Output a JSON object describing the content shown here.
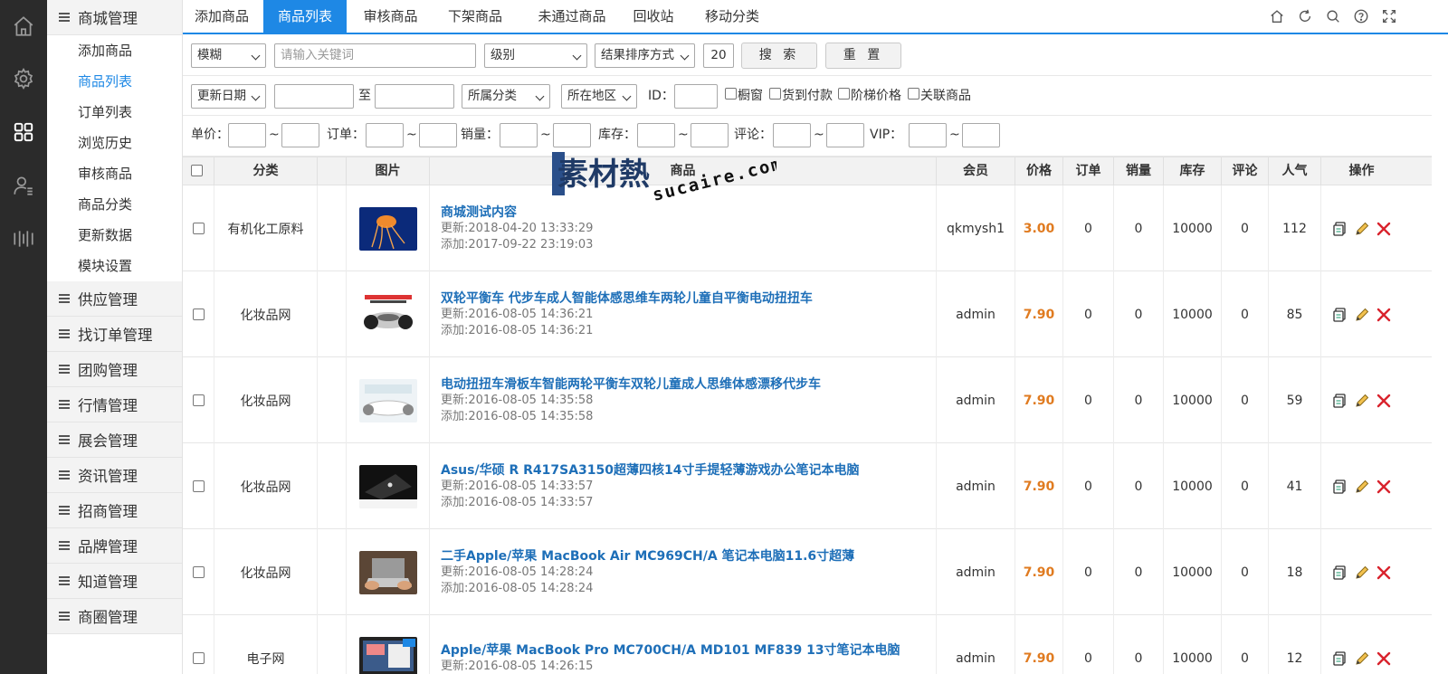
{
  "tabs": [
    {
      "label": "添加商品",
      "active": false
    },
    {
      "label": "商品列表",
      "active": true
    },
    {
      "label": "审核商品",
      "active": false
    },
    {
      "label": "下架商品",
      "active": false
    },
    {
      "label": "未通过商品",
      "active": false
    },
    {
      "label": "回收站",
      "active": false
    },
    {
      "label": "移动分类",
      "active": false
    }
  ],
  "rail": {
    "icons": [
      "home-icon",
      "settings-icon",
      "apps-icon",
      "user-list-icon",
      "bars-icon"
    ],
    "active": "apps-icon"
  },
  "menu": {
    "mall_group": "商城管理",
    "mall_items": [
      {
        "label": "添加商品",
        "active": false
      },
      {
        "label": "商品列表",
        "active": true
      },
      {
        "label": "订单列表",
        "active": false
      },
      {
        "label": "浏览历史",
        "active": false
      },
      {
        "label": "审核商品",
        "active": false
      },
      {
        "label": "商品分类",
        "active": false
      },
      {
        "label": "更新数据",
        "active": false
      },
      {
        "label": "模块设置",
        "active": false
      }
    ],
    "groups": [
      "供应管理",
      "找订单管理",
      "团购管理",
      "行情管理",
      "展会管理",
      "资讯管理",
      "招商管理",
      "品牌管理",
      "知道管理",
      "商圈管理"
    ]
  },
  "filters": {
    "match_mode": "模糊",
    "keyword_placeholder": "请输入关键词",
    "level": "级别",
    "sort": "结果排序方式",
    "page_size": "20",
    "search_button": "搜 索",
    "reset_button": "重 置",
    "date_field": "更新日期",
    "date_to": "至",
    "category": "所属分类",
    "region": "所在地区",
    "id_label": "ID：",
    "checks": [
      "橱窗",
      "货到付款",
      "阶梯价格",
      "关联商品"
    ],
    "ranges": [
      {
        "label": "单价："
      },
      {
        "label": "订单："
      },
      {
        "label": "销量："
      },
      {
        "label": "库存："
      },
      {
        "label": "评论："
      },
      {
        "label": "VIP："
      }
    ],
    "range_sep": "~"
  },
  "table": {
    "headers": {
      "category": "分类",
      "image": "图片",
      "goods": "商品",
      "member": "会员",
      "price": "价格",
      "orders": "订单",
      "sales": "销量",
      "stock": "库存",
      "reviews": "评论",
      "popularity": "人气",
      "actions": "操作"
    },
    "rows": [
      {
        "category": "有机化工原料",
        "title": "商城测试内容",
        "updated": "更新:2018-04-20 13:33:29",
        "added": "添加:2017-09-22 23:19:03",
        "member": "qkmysh1",
        "price": "3.00",
        "orders": "0",
        "sales": "0",
        "stock": "10000",
        "reviews": "0",
        "popularity": "112",
        "thumb": "jellyfish"
      },
      {
        "category": "化妆品网",
        "title": "双轮平衡车 代步车成人智能体感思维车两轮儿童自平衡电动扭扭车",
        "updated": "更新:2016-08-05 14:36:21",
        "added": "添加:2016-08-05 14:36:21",
        "member": "admin",
        "price": "7.90",
        "orders": "0",
        "sales": "0",
        "stock": "10000",
        "reviews": "0",
        "popularity": "85",
        "thumb": "hoverboard"
      },
      {
        "category": "化妆品网",
        "title": "电动扭扭车滑板车智能两轮平衡车双轮儿童成人思维体感漂移代步车",
        "updated": "更新:2016-08-05 14:35:58",
        "added": "添加:2016-08-05 14:35:58",
        "member": "admin",
        "price": "7.90",
        "orders": "0",
        "sales": "0",
        "stock": "10000",
        "reviews": "0",
        "popularity": "59",
        "thumb": "white-board"
      },
      {
        "category": "化妆品网",
        "title": "Asus/华硕 R R417SA3150超薄四核14寸手提轻薄游戏办公笔记本电脑",
        "updated": "更新:2016-08-05 14:33:57",
        "added": "添加:2016-08-05 14:33:57",
        "member": "admin",
        "price": "7.90",
        "orders": "0",
        "sales": "0",
        "stock": "10000",
        "reviews": "0",
        "popularity": "41",
        "thumb": "laptop-dark"
      },
      {
        "category": "化妆品网",
        "title": "二手Apple/苹果 MacBook Air MC969CH/A 笔记本电脑11.6寸超薄",
        "updated": "更新:2016-08-05 14:28:24",
        "added": "添加:2016-08-05 14:28:24",
        "member": "admin",
        "price": "7.90",
        "orders": "0",
        "sales": "0",
        "stock": "10000",
        "reviews": "0",
        "popularity": "18",
        "thumb": "laptop-hands"
      },
      {
        "category": "电子网",
        "title": "Apple/苹果 MacBook Pro MC700CH/A MD101 MF839 13寸笔记本电脑",
        "updated": "更新:2016-08-05 14:26:15",
        "added": "",
        "member": "admin",
        "price": "7.90",
        "orders": "0",
        "sales": "0",
        "stock": "10000",
        "reviews": "0",
        "popularity": "12",
        "thumb": "macbook-pro"
      }
    ]
  },
  "watermark": {
    "text_cn": "素材熱",
    "text_en": "sucaire.com"
  },
  "colors": {
    "accent": "#1e88e5",
    "price": "#e07b20",
    "rail": "#2b2b2b",
    "link": "#1e6fb8",
    "delete": "#d9232d"
  }
}
